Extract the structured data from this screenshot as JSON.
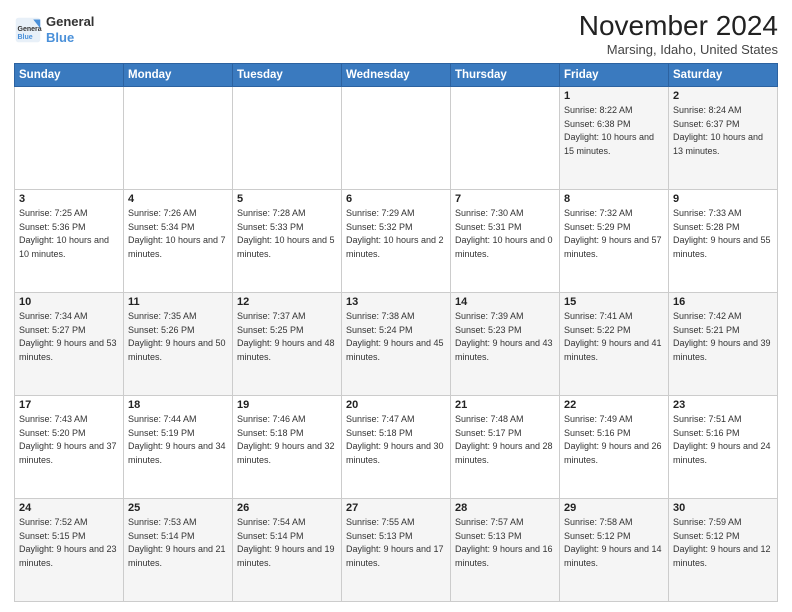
{
  "logo": {
    "line1": "General",
    "line2": "Blue"
  },
  "title": "November 2024",
  "location": "Marsing, Idaho, United States",
  "weekdays": [
    "Sunday",
    "Monday",
    "Tuesday",
    "Wednesday",
    "Thursday",
    "Friday",
    "Saturday"
  ],
  "weeks": [
    [
      {
        "day": "",
        "sunrise": "",
        "sunset": "",
        "daylight": ""
      },
      {
        "day": "",
        "sunrise": "",
        "sunset": "",
        "daylight": ""
      },
      {
        "day": "",
        "sunrise": "",
        "sunset": "",
        "daylight": ""
      },
      {
        "day": "",
        "sunrise": "",
        "sunset": "",
        "daylight": ""
      },
      {
        "day": "",
        "sunrise": "",
        "sunset": "",
        "daylight": ""
      },
      {
        "day": "1",
        "sunrise": "Sunrise: 8:22 AM",
        "sunset": "Sunset: 6:38 PM",
        "daylight": "Daylight: 10 hours and 15 minutes."
      },
      {
        "day": "2",
        "sunrise": "Sunrise: 8:24 AM",
        "sunset": "Sunset: 6:37 PM",
        "daylight": "Daylight: 10 hours and 13 minutes."
      }
    ],
    [
      {
        "day": "3",
        "sunrise": "Sunrise: 7:25 AM",
        "sunset": "Sunset: 5:36 PM",
        "daylight": "Daylight: 10 hours and 10 minutes."
      },
      {
        "day": "4",
        "sunrise": "Sunrise: 7:26 AM",
        "sunset": "Sunset: 5:34 PM",
        "daylight": "Daylight: 10 hours and 7 minutes."
      },
      {
        "day": "5",
        "sunrise": "Sunrise: 7:28 AM",
        "sunset": "Sunset: 5:33 PM",
        "daylight": "Daylight: 10 hours and 5 minutes."
      },
      {
        "day": "6",
        "sunrise": "Sunrise: 7:29 AM",
        "sunset": "Sunset: 5:32 PM",
        "daylight": "Daylight: 10 hours and 2 minutes."
      },
      {
        "day": "7",
        "sunrise": "Sunrise: 7:30 AM",
        "sunset": "Sunset: 5:31 PM",
        "daylight": "Daylight: 10 hours and 0 minutes."
      },
      {
        "day": "8",
        "sunrise": "Sunrise: 7:32 AM",
        "sunset": "Sunset: 5:29 PM",
        "daylight": "Daylight: 9 hours and 57 minutes."
      },
      {
        "day": "9",
        "sunrise": "Sunrise: 7:33 AM",
        "sunset": "Sunset: 5:28 PM",
        "daylight": "Daylight: 9 hours and 55 minutes."
      }
    ],
    [
      {
        "day": "10",
        "sunrise": "Sunrise: 7:34 AM",
        "sunset": "Sunset: 5:27 PM",
        "daylight": "Daylight: 9 hours and 53 minutes."
      },
      {
        "day": "11",
        "sunrise": "Sunrise: 7:35 AM",
        "sunset": "Sunset: 5:26 PM",
        "daylight": "Daylight: 9 hours and 50 minutes."
      },
      {
        "day": "12",
        "sunrise": "Sunrise: 7:37 AM",
        "sunset": "Sunset: 5:25 PM",
        "daylight": "Daylight: 9 hours and 48 minutes."
      },
      {
        "day": "13",
        "sunrise": "Sunrise: 7:38 AM",
        "sunset": "Sunset: 5:24 PM",
        "daylight": "Daylight: 9 hours and 45 minutes."
      },
      {
        "day": "14",
        "sunrise": "Sunrise: 7:39 AM",
        "sunset": "Sunset: 5:23 PM",
        "daylight": "Daylight: 9 hours and 43 minutes."
      },
      {
        "day": "15",
        "sunrise": "Sunrise: 7:41 AM",
        "sunset": "Sunset: 5:22 PM",
        "daylight": "Daylight: 9 hours and 41 minutes."
      },
      {
        "day": "16",
        "sunrise": "Sunrise: 7:42 AM",
        "sunset": "Sunset: 5:21 PM",
        "daylight": "Daylight: 9 hours and 39 minutes."
      }
    ],
    [
      {
        "day": "17",
        "sunrise": "Sunrise: 7:43 AM",
        "sunset": "Sunset: 5:20 PM",
        "daylight": "Daylight: 9 hours and 37 minutes."
      },
      {
        "day": "18",
        "sunrise": "Sunrise: 7:44 AM",
        "sunset": "Sunset: 5:19 PM",
        "daylight": "Daylight: 9 hours and 34 minutes."
      },
      {
        "day": "19",
        "sunrise": "Sunrise: 7:46 AM",
        "sunset": "Sunset: 5:18 PM",
        "daylight": "Daylight: 9 hours and 32 minutes."
      },
      {
        "day": "20",
        "sunrise": "Sunrise: 7:47 AM",
        "sunset": "Sunset: 5:18 PM",
        "daylight": "Daylight: 9 hours and 30 minutes."
      },
      {
        "day": "21",
        "sunrise": "Sunrise: 7:48 AM",
        "sunset": "Sunset: 5:17 PM",
        "daylight": "Daylight: 9 hours and 28 minutes."
      },
      {
        "day": "22",
        "sunrise": "Sunrise: 7:49 AM",
        "sunset": "Sunset: 5:16 PM",
        "daylight": "Daylight: 9 hours and 26 minutes."
      },
      {
        "day": "23",
        "sunrise": "Sunrise: 7:51 AM",
        "sunset": "Sunset: 5:16 PM",
        "daylight": "Daylight: 9 hours and 24 minutes."
      }
    ],
    [
      {
        "day": "24",
        "sunrise": "Sunrise: 7:52 AM",
        "sunset": "Sunset: 5:15 PM",
        "daylight": "Daylight: 9 hours and 23 minutes."
      },
      {
        "day": "25",
        "sunrise": "Sunrise: 7:53 AM",
        "sunset": "Sunset: 5:14 PM",
        "daylight": "Daylight: 9 hours and 21 minutes."
      },
      {
        "day": "26",
        "sunrise": "Sunrise: 7:54 AM",
        "sunset": "Sunset: 5:14 PM",
        "daylight": "Daylight: 9 hours and 19 minutes."
      },
      {
        "day": "27",
        "sunrise": "Sunrise: 7:55 AM",
        "sunset": "Sunset: 5:13 PM",
        "daylight": "Daylight: 9 hours and 17 minutes."
      },
      {
        "day": "28",
        "sunrise": "Sunrise: 7:57 AM",
        "sunset": "Sunset: 5:13 PM",
        "daylight": "Daylight: 9 hours and 16 minutes."
      },
      {
        "day": "29",
        "sunrise": "Sunrise: 7:58 AM",
        "sunset": "Sunset: 5:12 PM",
        "daylight": "Daylight: 9 hours and 14 minutes."
      },
      {
        "day": "30",
        "sunrise": "Sunrise: 7:59 AM",
        "sunset": "Sunset: 5:12 PM",
        "daylight": "Daylight: 9 hours and 12 minutes."
      }
    ]
  ]
}
